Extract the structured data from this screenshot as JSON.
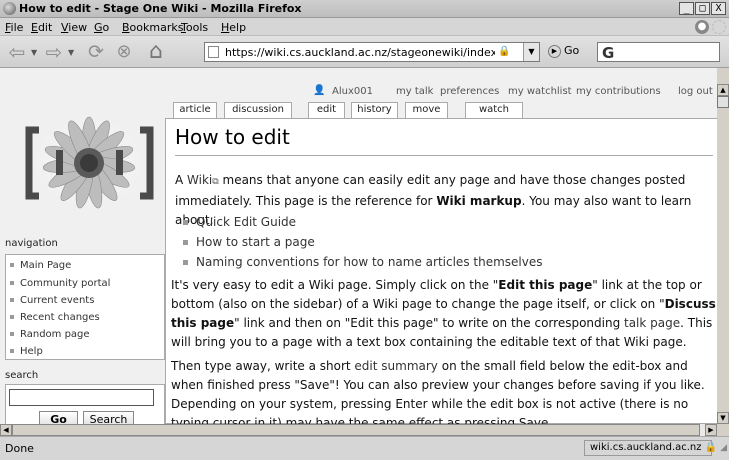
{
  "window": {
    "title": "How to edit - Stage One Wiki - Mozilla Firefox",
    "controls": [
      "_",
      "□",
      "X"
    ]
  },
  "menu": [
    "File",
    "Edit",
    "View",
    "Go",
    "Bookmarks",
    "Tools",
    "Help"
  ],
  "navbar": {
    "url": "https://wiki.cs.auckland.ac.nz/stageonewiki/index.php/How_",
    "go_label": "Go",
    "search_glyph": "G"
  },
  "personal": {
    "user": "Alux001",
    "links": [
      "my talk",
      "preferences",
      "my watchlist",
      "my contributions",
      "log out"
    ]
  },
  "tabs": [
    "article",
    "discussion",
    "edit",
    "history",
    "move",
    "watch"
  ],
  "sidebar": {
    "navigation_heading": "navigation",
    "nav_items": [
      "Main Page",
      "Community portal",
      "Current events",
      "Recent changes",
      "Random page",
      "Help"
    ],
    "search_heading": "search",
    "search_value": "",
    "go_button": "Go",
    "search_button": "Search"
  },
  "article": {
    "title": "How to edit",
    "intro_1_a": "A ",
    "intro_1_link": "Wiki",
    "intro_1_b": " means that anyone can easily edit any page and have those changes posted immediately. This page is the reference for ",
    "intro_1_bold": "Wiki markup",
    "intro_1_c": ". You may also want to learn about:",
    "bullets": [
      "Quick Edit Guide",
      "How to start a page",
      "Naming conventions for how to name articles themselves"
    ],
    "p2_a": "It's very easy to edit a Wiki page. Simply click on the \"",
    "p2_bold1": "Edit this page",
    "p2_b": "\" link at the top or bottom (also on the sidebar) of a Wiki page to change the page itself, or click on \"",
    "p2_bold2": "Discuss this page",
    "p2_c": "\" link and then on \"Edit this page\" to write on the corresponding ",
    "p2_link": "talk page",
    "p2_d": ". This will bring you to a page with a text box containing the editable text of that Wiki page.",
    "p3_a": "Then type away, write a short ",
    "p3_link": "edit summary",
    "p3_b": " on the small field below the edit-box and when finished press \"Save\"! You can also preview your changes before saving if you like. Depending on your system, pressing Enter while the edit box is not active (there is no typing cursor in it) may have the same effect as pressing Save."
  },
  "status": {
    "text": "Done",
    "host": "wiki.cs.auckland.ac.nz"
  }
}
